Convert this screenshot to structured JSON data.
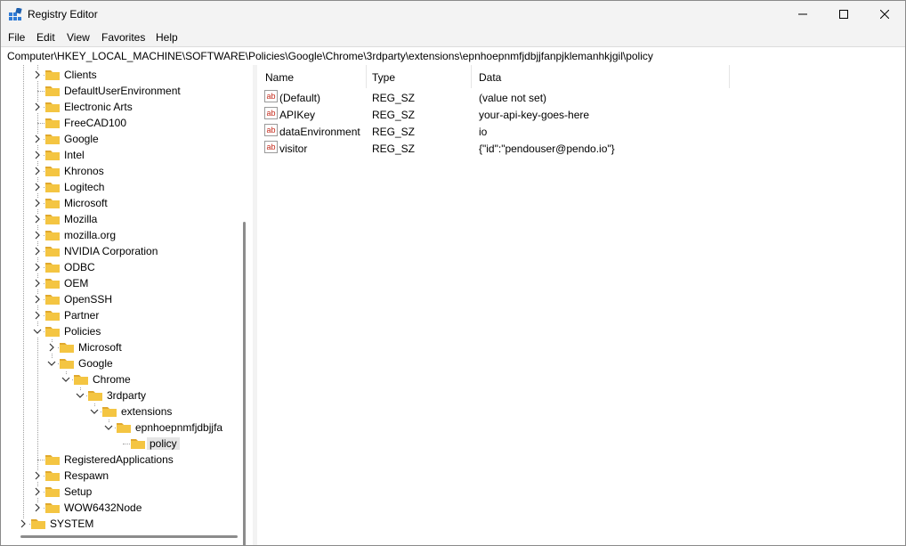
{
  "window": {
    "title": "Registry Editor",
    "controls": [
      "minimize",
      "maximize",
      "close"
    ]
  },
  "menu": [
    "File",
    "Edit",
    "View",
    "Favorites",
    "Help"
  ],
  "address": "Computer\\HKEY_LOCAL_MACHINE\\SOFTWARE\\Policies\\Google\\Chrome\\3rdparty\\extensions\\epnhoepnmfjdbjjfanpjklemanhkjgil\\policy",
  "tree": [
    {
      "label": "Clients",
      "level": 2,
      "state": "collapsed"
    },
    {
      "label": "DefaultUserEnvironment",
      "level": 2,
      "state": "none"
    },
    {
      "label": "Electronic Arts",
      "level": 2,
      "state": "collapsed"
    },
    {
      "label": "FreeCAD100",
      "level": 2,
      "state": "none"
    },
    {
      "label": "Google",
      "level": 2,
      "state": "collapsed"
    },
    {
      "label": "Intel",
      "level": 2,
      "state": "collapsed"
    },
    {
      "label": "Khronos",
      "level": 2,
      "state": "collapsed"
    },
    {
      "label": "Logitech",
      "level": 2,
      "state": "collapsed"
    },
    {
      "label": "Microsoft",
      "level": 2,
      "state": "collapsed"
    },
    {
      "label": "Mozilla",
      "level": 2,
      "state": "collapsed"
    },
    {
      "label": "mozilla.org",
      "level": 2,
      "state": "collapsed"
    },
    {
      "label": "NVIDIA Corporation",
      "level": 2,
      "state": "collapsed"
    },
    {
      "label": "ODBC",
      "level": 2,
      "state": "collapsed"
    },
    {
      "label": "OEM",
      "level": 2,
      "state": "collapsed"
    },
    {
      "label": "OpenSSH",
      "level": 2,
      "state": "collapsed"
    },
    {
      "label": "Partner",
      "level": 2,
      "state": "collapsed"
    },
    {
      "label": "Policies",
      "level": 2,
      "state": "expanded"
    },
    {
      "label": "Microsoft",
      "level": 3,
      "state": "collapsed"
    },
    {
      "label": "Google",
      "level": 3,
      "state": "expanded"
    },
    {
      "label": "Chrome",
      "level": 4,
      "state": "expanded"
    },
    {
      "label": "3rdparty",
      "level": 5,
      "state": "expanded"
    },
    {
      "label": "extensions",
      "level": 6,
      "state": "expanded"
    },
    {
      "label": "epnhoepnmfjdbjjfa",
      "level": 7,
      "state": "expanded"
    },
    {
      "label": "policy",
      "level": 8,
      "state": "none",
      "selected": true
    },
    {
      "label": "RegisteredApplications",
      "level": 2,
      "state": "none"
    },
    {
      "label": "Respawn",
      "level": 2,
      "state": "collapsed"
    },
    {
      "label": "Setup",
      "level": 2,
      "state": "collapsed"
    },
    {
      "label": "WOW6432Node",
      "level": 2,
      "state": "collapsed"
    },
    {
      "label": "SYSTEM",
      "level": 1,
      "state": "collapsed"
    }
  ],
  "list": {
    "columns": [
      "Name",
      "Type",
      "Data"
    ],
    "rows": [
      {
        "name": "(Default)",
        "type": "REG_SZ",
        "data": "(value not set)",
        "icon": "string-value-icon"
      },
      {
        "name": "APIKey",
        "type": "REG_SZ",
        "data": "your-api-key-goes-here",
        "icon": "string-value-icon"
      },
      {
        "name": "dataEnvironment",
        "type": "REG_SZ",
        "data": "io",
        "icon": "string-value-icon"
      },
      {
        "name": "visitor",
        "type": "REG_SZ",
        "data": "{\"id\":\"pendouser@pendo.io\"}",
        "icon": "string-value-icon"
      }
    ]
  },
  "colors": {
    "folder": "#f4c542",
    "folder_dark": "#e0a82e",
    "selection": "#e5e5e5",
    "ab_red": "#c42b1c"
  }
}
